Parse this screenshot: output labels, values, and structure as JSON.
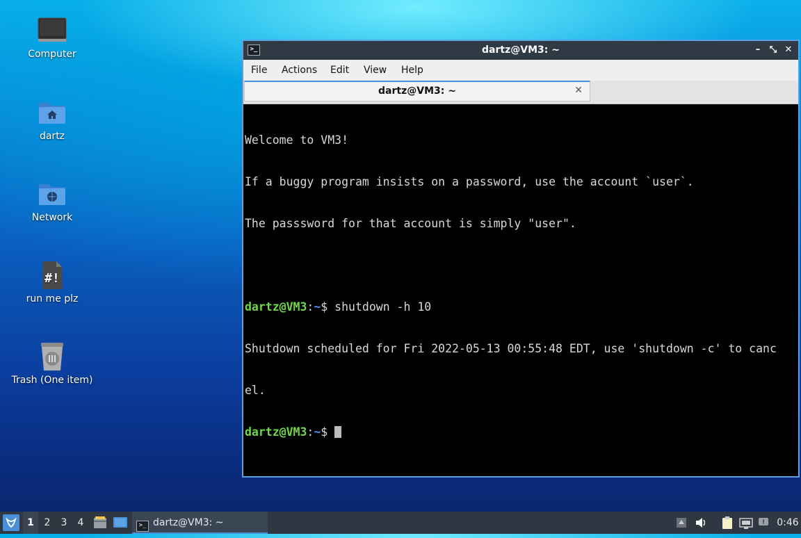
{
  "desktop": {
    "icons": [
      {
        "label": "Computer",
        "icon": "monitor-icon"
      },
      {
        "label": "dartz",
        "icon": "home-folder-icon"
      },
      {
        "label": "Network",
        "icon": "network-folder-icon"
      },
      {
        "label": "run me plz",
        "icon": "script-file-icon"
      },
      {
        "label": "Trash (One item)",
        "icon": "trash-icon"
      }
    ]
  },
  "window": {
    "title": "dartz@VM3: ~",
    "controls": {
      "minimize": "–",
      "restore": "⤡",
      "maximize": "⤢",
      "close": "✕"
    },
    "menu": [
      "File",
      "Actions",
      "Edit",
      "View",
      "Help"
    ],
    "tab": {
      "label": "dartz@VM3: ~",
      "close": "✕"
    }
  },
  "terminal": {
    "welcome": [
      "Welcome to VM3!",
      "If a buggy program insists on a password, use the account `user`.",
      "The passsword for that account is simply \"user\"."
    ],
    "prompt_user": "dartz@VM3",
    "prompt_sep": ":",
    "prompt_path": "~",
    "prompt_symbol": "$ ",
    "command": "shutdown -h 10",
    "output": [
      "Shutdown scheduled for Fri 2022-05-13 00:55:48 EDT, use 'shutdown -c' to canc",
      "el."
    ]
  },
  "taskbar": {
    "workspaces": [
      "1",
      "2",
      "3",
      "4"
    ],
    "active_workspace": "1",
    "task_label": "dartz@VM3: ~",
    "clock": "0:46"
  },
  "colors": {
    "accent": "#4a90d9",
    "prompt_user": "#6ed84a",
    "prompt_path": "#5a8ff0",
    "terminal_bg": "#000000",
    "terminal_fg": "#d8d8d8"
  }
}
